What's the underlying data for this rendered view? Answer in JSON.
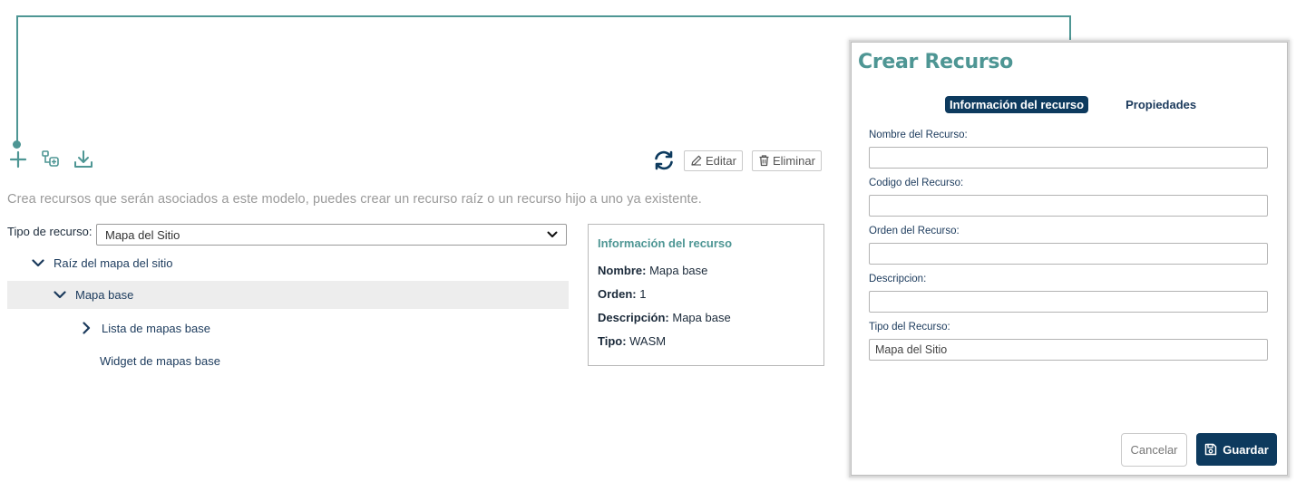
{
  "toolbar": {
    "add_icon": "plus-icon",
    "add_child_icon": "tree-add-icon",
    "download_icon": "download-icon",
    "refresh_icon": "refresh-icon",
    "edit_label": "Editar",
    "delete_label": "Eliminar"
  },
  "hint_text": "Crea recursos que serán asociados a este modelo, puedes crear un recurso raíz o un recurso hijo a uno ya existente.",
  "resource_type": {
    "label": "Tipo de recurso:",
    "selected": "Mapa del Sitio"
  },
  "tree": {
    "items": [
      {
        "label": "Raíz del mapa del sitio",
        "state": "expanded"
      },
      {
        "label": "Mapa base",
        "state": "expanded",
        "selected": true
      },
      {
        "label": "Lista de mapas base",
        "state": "collapsed"
      },
      {
        "label": "Widget de mapas base",
        "state": "leaf"
      }
    ]
  },
  "info_card": {
    "title": "Información del recurso",
    "name_label": "Nombre:",
    "name_value": " Mapa base",
    "order_label": "Orden:",
    "order_value": " 1",
    "description_label": "Descripción:",
    "description_value": " Mapa base",
    "type_label": "Tipo:",
    "type_value": " WASM"
  },
  "modal": {
    "title": "Crear Recurso",
    "tabs": [
      {
        "label": "Información del recurso",
        "active": true
      },
      {
        "label": "Propiedades",
        "active": false
      }
    ],
    "fields": {
      "name_label": "Nombre del Recurso:",
      "name_value": "",
      "code_label": "Codigo del Recurso:",
      "code_value": "",
      "order_label": "Orden del Recurso:",
      "order_value": "",
      "description_label": "Descripcion:",
      "description_value": "",
      "type_label": "Tipo del Recurso:",
      "type_value": "Mapa del Sitio"
    },
    "cancel_label": "Cancelar",
    "save_label": "Guardar"
  },
  "colors": {
    "accent": "#4e9694",
    "primary": "#0d3a5e",
    "selected_row": "#ededed"
  }
}
